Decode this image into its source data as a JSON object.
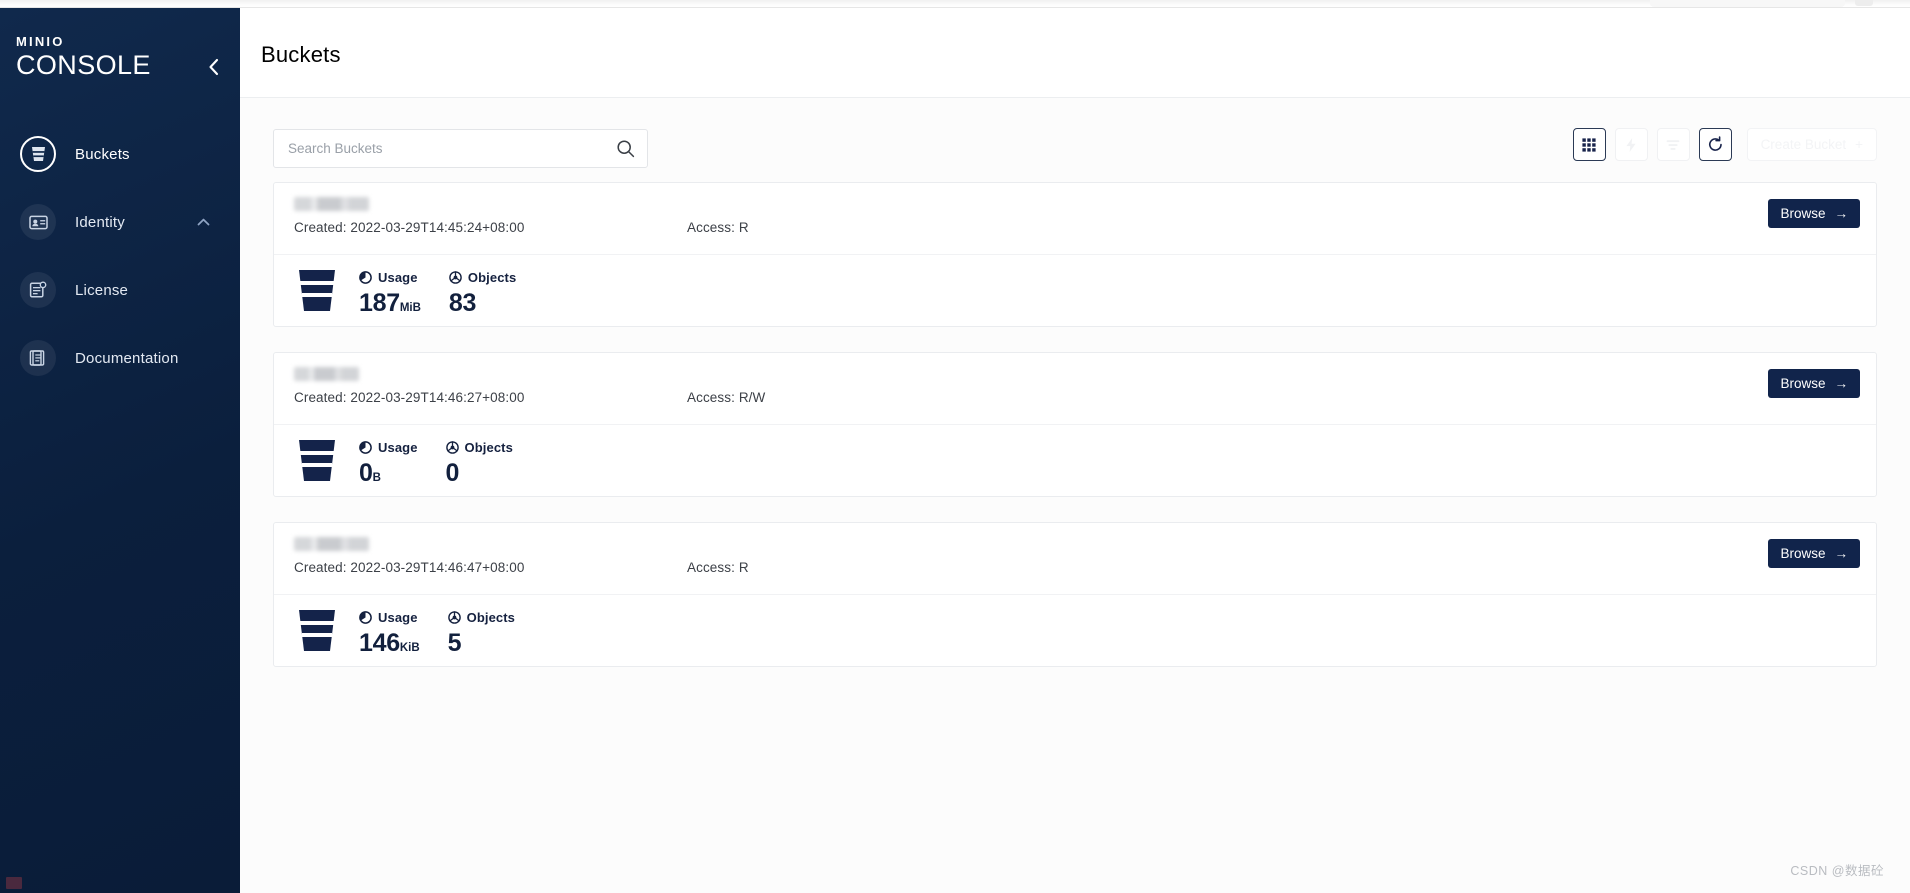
{
  "browser": {
    "tab_strip": "browser-chrome"
  },
  "sidebar": {
    "logo_top": "MINIO",
    "logo_bottom": "CONSOLE",
    "collapse_icon": "chevron-left-icon",
    "items": [
      {
        "label": "Buckets",
        "icon": "bucket-icon",
        "active": true,
        "expandable": false
      },
      {
        "label": "Identity",
        "icon": "id-card-icon",
        "active": false,
        "expandable": true,
        "expand_icon": "chevron-up-icon"
      },
      {
        "label": "License",
        "icon": "license-badge-icon",
        "active": false,
        "expandable": false
      },
      {
        "label": "Documentation",
        "icon": "book-icon",
        "active": false,
        "expandable": false
      }
    ]
  },
  "header": {
    "title": "Buckets"
  },
  "search": {
    "placeholder": "Search Buckets",
    "value": "",
    "icon": "search-icon"
  },
  "toolbar": {
    "buttons": [
      {
        "name": "tiles-view-button",
        "icon": "grid-icon",
        "state": "active"
      },
      {
        "name": "lifecycle-button",
        "icon": "bolt-icon",
        "state": "disabled"
      },
      {
        "name": "filter-button",
        "icon": "filter-icon",
        "state": "disabled"
      },
      {
        "name": "refresh-button",
        "icon": "refresh-icon",
        "state": "enabled"
      }
    ],
    "create_label": "Create Bucket",
    "create_plus": "+",
    "create_state": "disabled"
  },
  "buckets": {
    "browse_label": "Browse",
    "browse_arrow": "→",
    "usage_label": "Usage",
    "objects_label": "Objects",
    "created_prefix": "Created:",
    "access_prefix": "Access:",
    "items": [
      {
        "name_redacted": true,
        "name_width": 75,
        "created": "Created: 2022-03-29T14:45:24+08:00",
        "access": "Access: R",
        "usage_value": "187",
        "usage_unit": "MiB",
        "objects_value": "83"
      },
      {
        "name_redacted": true,
        "name_width": 65,
        "created": "Created: 2022-03-29T14:46:27+08:00",
        "access": "Access: R/W",
        "usage_value": "0",
        "usage_unit": "B",
        "objects_value": "0"
      },
      {
        "name_redacted": true,
        "name_width": 75,
        "created": "Created: 2022-03-29T14:46:47+08:00",
        "access": "Access: R",
        "usage_value": "146",
        "usage_unit": "KiB",
        "objects_value": "5"
      }
    ]
  },
  "watermark": {
    "text": "CSDN @数据砼"
  },
  "colors": {
    "sidebar_bg": "#0c2344",
    "accent_navy": "#11244b",
    "page_bg": "#fcfcfc",
    "card_border": "#eaecef",
    "text_primary": "#12203d",
    "text_muted": "#9aa0a8"
  }
}
